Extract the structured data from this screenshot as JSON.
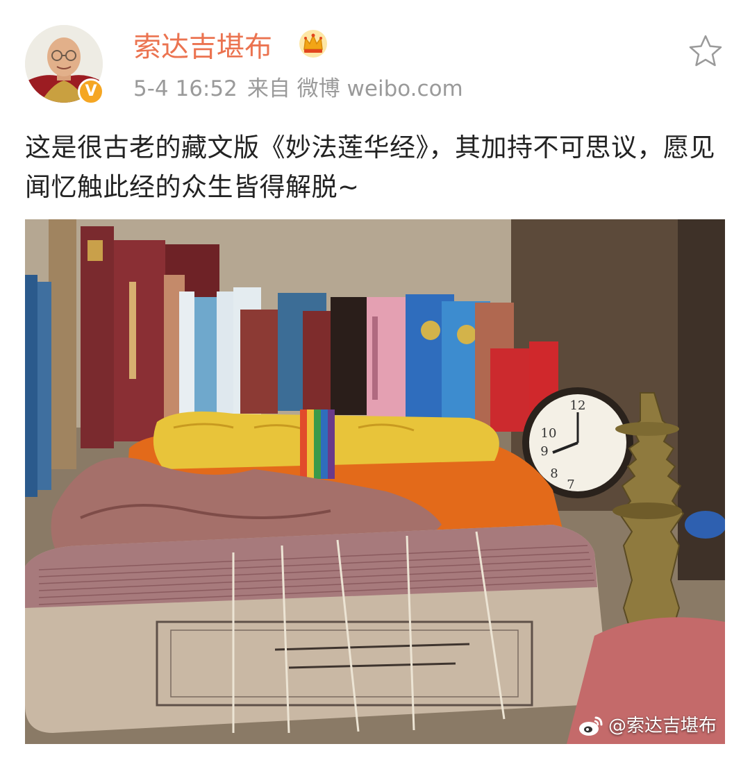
{
  "post": {
    "author": {
      "name": "索达吉堪布",
      "verified_badge": "V",
      "member_icon": "crown-icon"
    },
    "timestamp": "5-4 16:52",
    "source": "来自 微博 weibo.com",
    "text": "这是很古老的藏文版《妙法莲华经》，其加持不可思议，愿见闻忆触此经的众生皆得解脱~",
    "favorite_icon": "star-icon",
    "image": {
      "watermark": "@索达吉堪布"
    }
  },
  "colors": {
    "author_name": "#eb7350",
    "meta_text": "#9a9a9a",
    "body_text": "#222222",
    "badge": "#f5a623"
  }
}
